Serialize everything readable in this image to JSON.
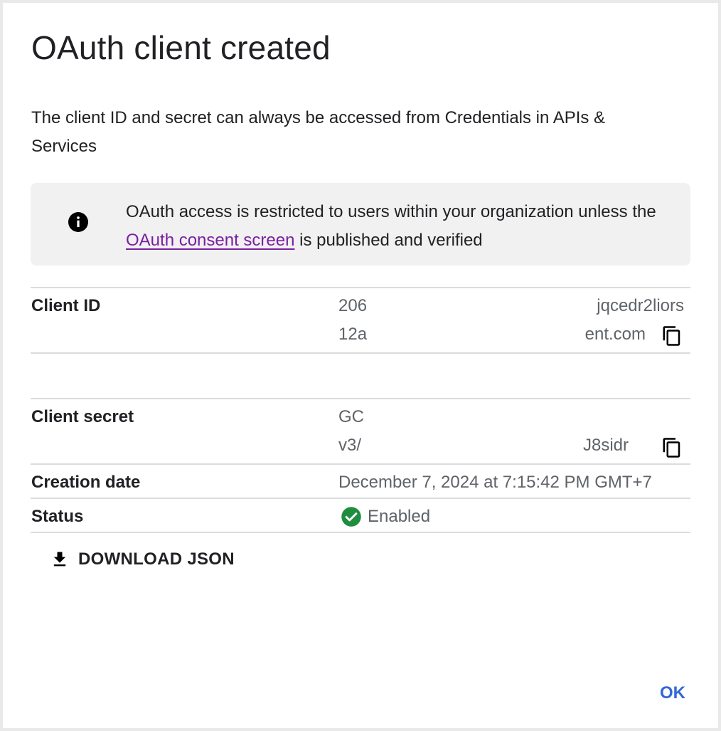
{
  "dialog": {
    "title": "OAuth client created",
    "description": "The client ID and secret can always be accessed from Credentials in APIs & Services"
  },
  "notice": {
    "icon": "info-icon",
    "text_before": "OAuth access is restricted to users within your organization unless the ",
    "link_text": "OAuth consent screen",
    "text_after": " is published and verified"
  },
  "details": {
    "client_id": {
      "label": "Client ID",
      "line1_start": "206",
      "line1_end": "jqcedr2liors",
      "line2_start": "12a",
      "line2_end": "ent.com",
      "copy_icon": "copy-icon"
    },
    "client_secret": {
      "label": "Client secret",
      "line1_start": "GC",
      "line2_start": "v3/",
      "line2_end": "J8sidr",
      "copy_icon": "copy-icon"
    },
    "creation_date": {
      "label": "Creation date",
      "value": "December 7, 2024 at 7:15:42 PM GMT+7"
    },
    "status": {
      "label": "Status",
      "value": "Enabled",
      "icon": "check-circle-icon",
      "color": "#1e8e3e"
    }
  },
  "actions": {
    "download_label": "DOWNLOAD JSON",
    "download_icon": "download-icon",
    "ok_label": "OK"
  },
  "colors": {
    "link": "#7b1fa2",
    "primary_button": "#3367d6",
    "notice_background": "#f1f1f1"
  }
}
